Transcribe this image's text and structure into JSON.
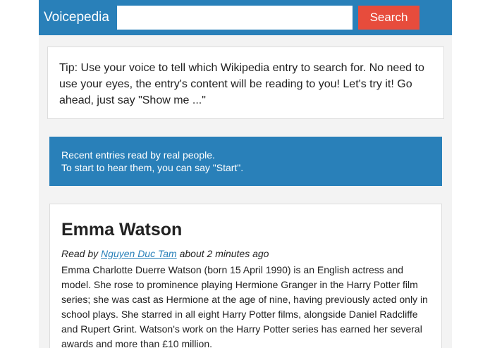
{
  "navbar": {
    "brand": "Voicepedia",
    "search_placeholder": "",
    "search_value": "",
    "search_button_label": "Search"
  },
  "tip": {
    "text": "Tip: Use your voice to tell which Wikipedia entry to search for. No need to use your eyes, the entry's content will be reading to you! Let's try it! Go ahead, just say \"Show me ...\""
  },
  "recent": {
    "line1": "Recent entries read by real people.",
    "line2": "To start to hear them, you can say \"Start\"."
  },
  "entry": {
    "title": "Emma Watson",
    "read_by_prefix": "Read by",
    "reader_name": "Nguyen Duc Tam",
    "time_ago": "about 2 minutes ago",
    "content": "Emma Charlotte Duerre Watson (born 15 April 1990) is an English actress and model. She rose to prominence playing Hermione Granger in the Harry Potter film series; she was cast as Hermione at the age of nine, having previously acted only in school plays. She starred in all eight Harry Potter films, alongside Daniel Radcliffe and Rupert Grint. Watson's work on the Harry Potter series has earned her several awards and more than £10 million."
  },
  "colors": {
    "navbar_bg": "#2980b9",
    "search_button_bg": "#e74c3c",
    "recent_box_bg": "#2980b9",
    "page_bg": "#f3f3f3"
  }
}
